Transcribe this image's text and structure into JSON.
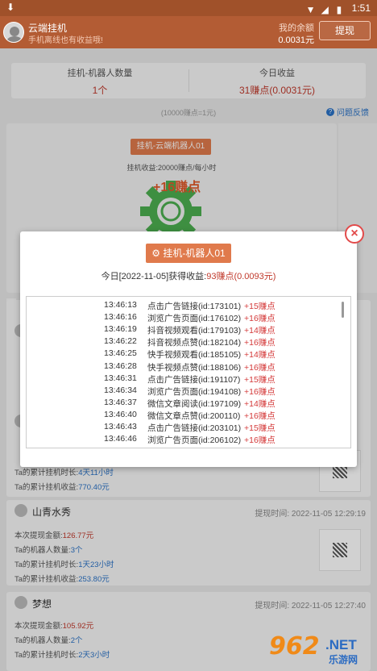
{
  "status_bar": {
    "time": "1:51"
  },
  "header": {
    "title": "云端挂机",
    "subtitle": "手机离线也有收益哦!",
    "balance_label": "我的余额",
    "balance_value": "0.0031元",
    "withdraw_button": "提现"
  },
  "stats": {
    "robots_label": "挂机-机器人数量",
    "robots_value": "1个",
    "today_label": "今日收益",
    "today_value": "31赚点(0.0031元)"
  },
  "rate_note": "(10000赚点=1元)",
  "feedback_label": "问题反馈",
  "robot": {
    "tag": "挂机-云端机器人01",
    "income": "挂机收益:20000赚点/每小时",
    "plus": "+16赚点"
  },
  "records": [
    {
      "lines": [
        {
          "label": "Ta的累计挂机时长:",
          "value": "4天11小时"
        },
        {
          "label": "Ta的累计挂机收益:",
          "value": "770.40元"
        }
      ]
    },
    {
      "name": "山青水秀",
      "time": "提现时间: 2022-11-05 12:29:19",
      "lines": [
        {
          "label": "本次提现金额:",
          "value": "126.77元"
        },
        {
          "label": "Ta的机器人数量:",
          "value": "3个"
        },
        {
          "label": "Ta的累计挂机时长:",
          "value": "1天23小时"
        },
        {
          "label": "Ta的累计挂机收益:",
          "value": "253.80元"
        }
      ]
    },
    {
      "name": "梦想",
      "time": "提现时间: 2022-11-05 12:27:40",
      "lines": [
        {
          "label": "本次提现金额:",
          "value": "105.92元"
        },
        {
          "label": "Ta的机器人数量:",
          "value": "2个"
        },
        {
          "label": "Ta的累计挂机时长:",
          "value": "2天3小时"
        }
      ]
    }
  ],
  "dialog": {
    "tag": "挂机-机器人01",
    "summary_prefix": "今日[2022-11-05]获得收益:",
    "summary_value": "93赚点(0.0093元)",
    "close": "×",
    "log": [
      {
        "time": "13:46:13",
        "action": "点击广告链接(id:173101)",
        "points": "+15赚点"
      },
      {
        "time": "13:46:16",
        "action": "浏览广告页面(id:176102)",
        "points": "+16赚点"
      },
      {
        "time": "13:46:19",
        "action": "抖音视频观看(id:179103)",
        "points": "+14赚点"
      },
      {
        "time": "13:46:22",
        "action": "抖音视频点赞(id:182104)",
        "points": "+16赚点"
      },
      {
        "time": "13:46:25",
        "action": "快手视频观看(id:185105)",
        "points": "+14赚点"
      },
      {
        "time": "13:46:28",
        "action": "快手视频点赞(id:188106)",
        "points": "+16赚点"
      },
      {
        "time": "13:46:31",
        "action": "点击广告链接(id:191107)",
        "points": "+15赚点"
      },
      {
        "time": "13:46:34",
        "action": "浏览广告页面(id:194108)",
        "points": "+16赚点"
      },
      {
        "time": "13:46:37",
        "action": "微信文章阅读(id:197109)",
        "points": "+14赚点"
      },
      {
        "time": "13:46:40",
        "action": "微信文章点赞(id:200110)",
        "points": "+16赚点"
      },
      {
        "time": "13:46:43",
        "action": "点击广告链接(id:203101)",
        "points": "+15赚点"
      },
      {
        "time": "13:46:46",
        "action": "浏览广告页面(id:206102)",
        "points": "+16赚点"
      }
    ]
  },
  "watermark": {
    "num": "962",
    "net": ".NET",
    "cn": "乐游网"
  }
}
